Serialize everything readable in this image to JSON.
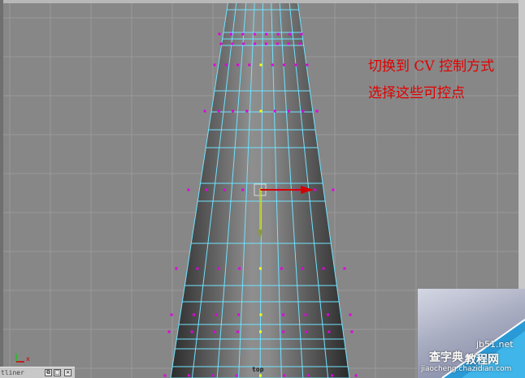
{
  "annotations": {
    "line1": "切换到 CV 控制方式",
    "line2": "选择这些可控点"
  },
  "viewport": {
    "view_name": "top",
    "axis_x_label": "x",
    "colors": {
      "background": "#878787",
      "grid": "#9a9a9a",
      "mesh_fill_dark": "#3a3a3a",
      "mesh_fill_light": "#8a8a8a",
      "wireframe": "#6fe3ff",
      "cv_point": "#e000e0",
      "cv_selected": "#ffff00",
      "annotation": "#e10000"
    }
  },
  "outliner": {
    "label": "tliner",
    "restore_label": "⧉",
    "maximize_label": "□",
    "close_label": "×"
  },
  "watermark": {
    "site_1": "查字典",
    "site_2": "教程网",
    "domain": "jb51.net",
    "url": "jiaocheng.chazidian.com"
  }
}
